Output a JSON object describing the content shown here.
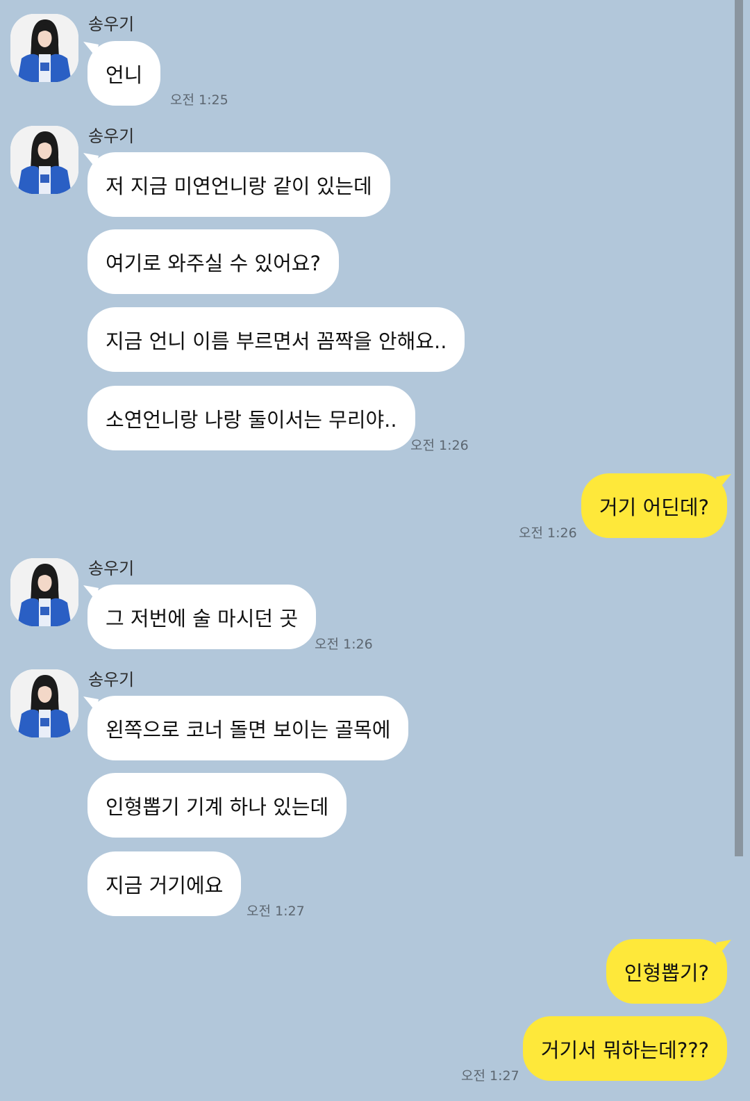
{
  "chat": {
    "colors": {
      "background": "#b2c7da",
      "incoming_bubble": "#ffffff",
      "outgoing_bubble": "#fee83a",
      "scrollbar": "#8a959f"
    },
    "contact": {
      "name": "송우기",
      "avatar": "avatar-photo"
    },
    "groups": [
      {
        "sender": "송우기",
        "messages": [
          "언니"
        ],
        "time": "오전 1:25"
      },
      {
        "sender": "송우기",
        "messages": [
          "저 지금 미연언니랑 같이 있는데",
          "여기로 와주실 수 있어요?",
          "지금 언니 이름 부르면서 꼼짝을 안해요..",
          "소연언니랑 나랑 둘이서는 무리야.."
        ],
        "time": "오전 1:26"
      },
      {
        "sender": "me",
        "messages": [
          "거기 어딘데?"
        ],
        "time": "오전 1:26"
      },
      {
        "sender": "송우기",
        "messages": [
          "그 저번에 술 마시던 곳"
        ],
        "time": "오전 1:26"
      },
      {
        "sender": "송우기",
        "messages": [
          "왼쪽으로 코너 돌면 보이는 골목에",
          "인형뽑기 기계 하나 있는데",
          "지금 거기에요"
        ],
        "time": "오전 1:27"
      },
      {
        "sender": "me",
        "messages": [
          "인형뽑기?",
          "거기서 뭐하는데???"
        ],
        "time": "오전 1:27"
      }
    ]
  }
}
